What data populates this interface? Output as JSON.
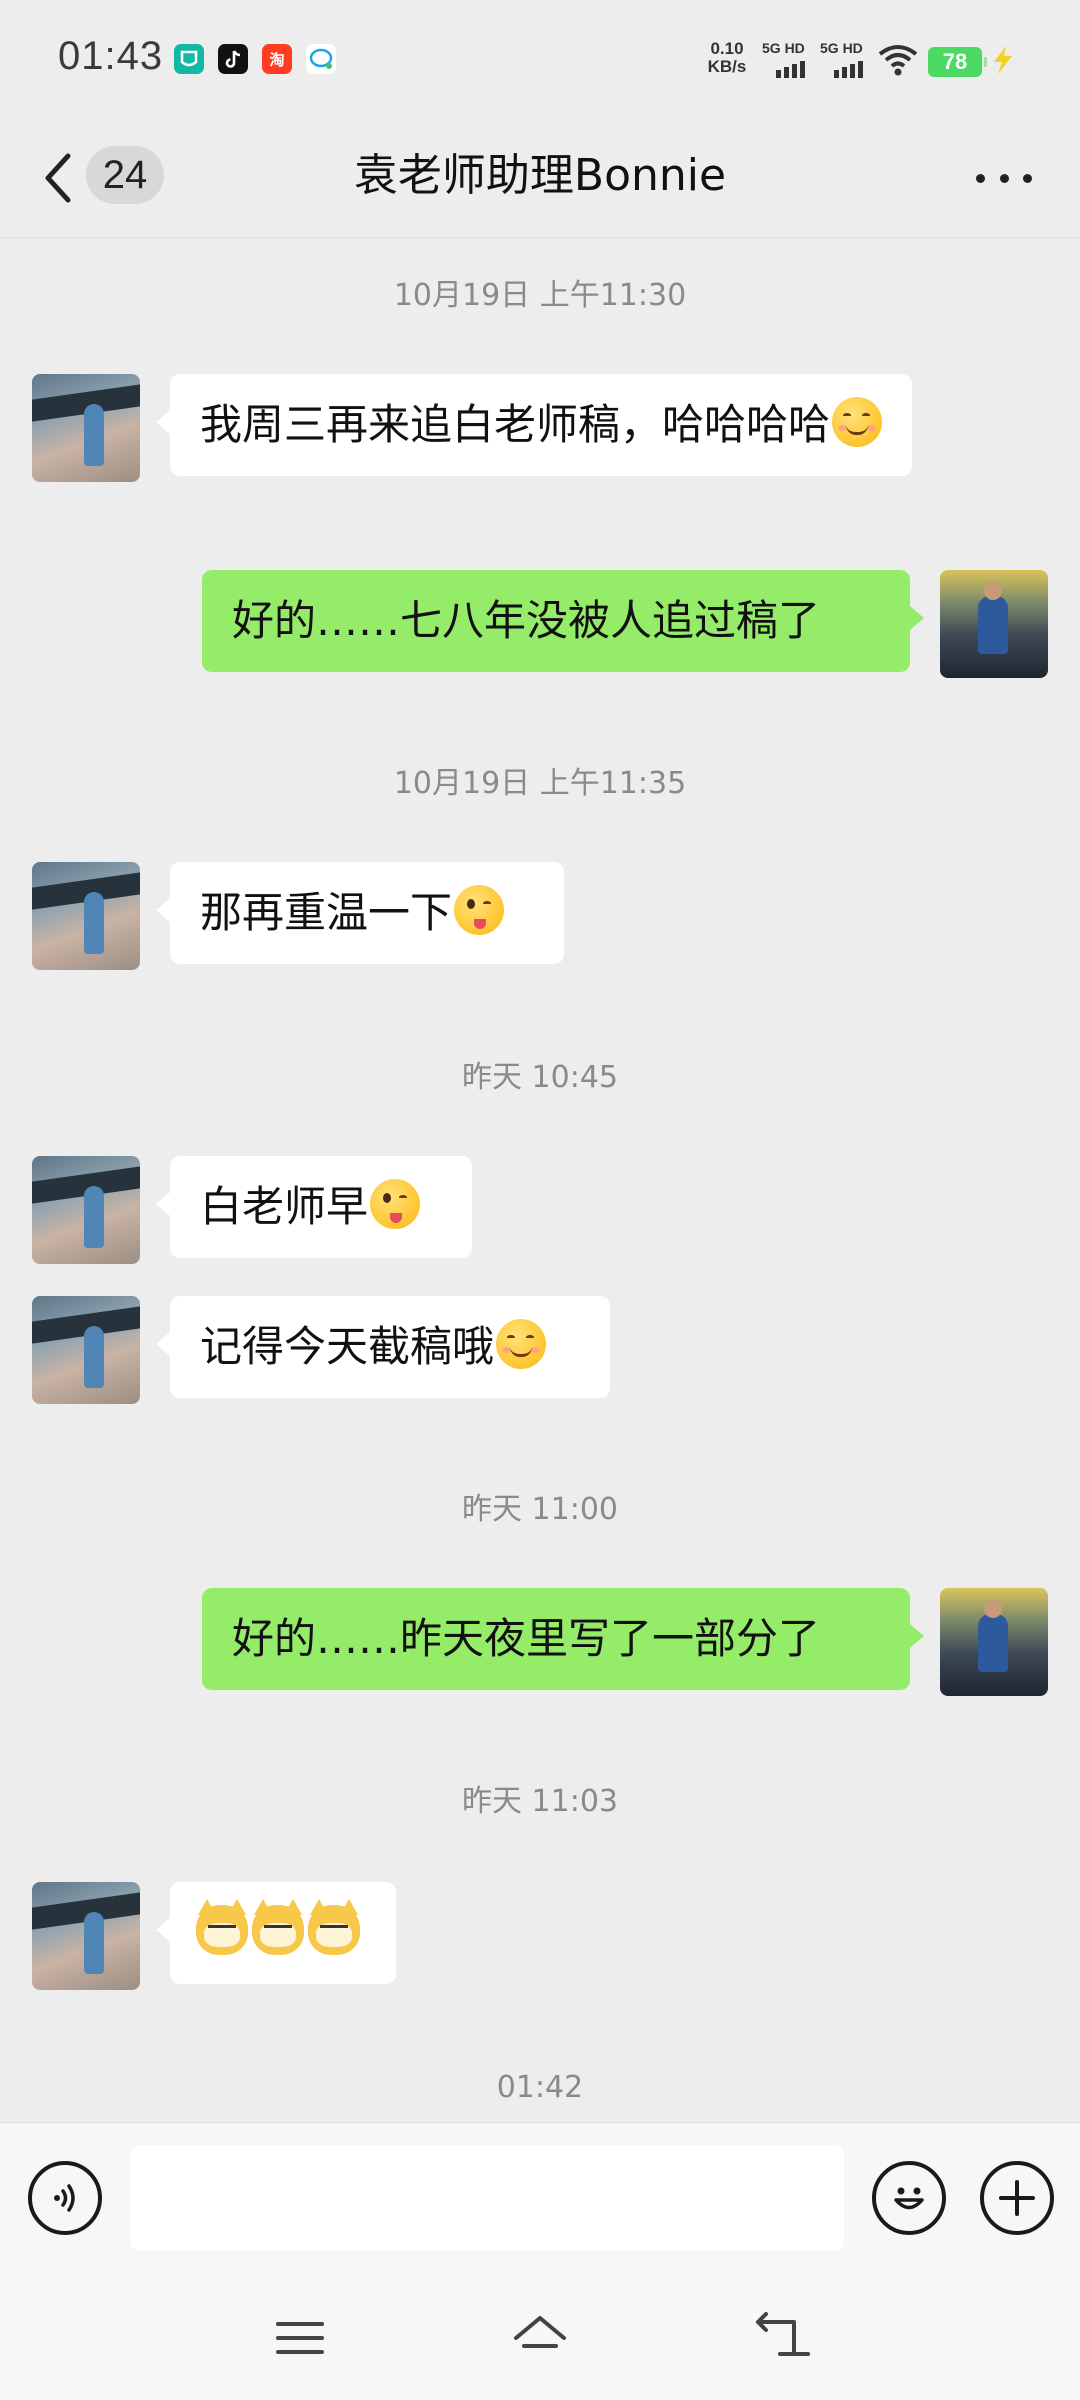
{
  "status_bar": {
    "time": "01:43",
    "net_speed_value": "0.10",
    "net_speed_unit": "KB/s",
    "sim1_label": "5G HD",
    "sim2_label": "5G HD",
    "battery": "78",
    "app_icons": [
      "mi-icon",
      "tiktok-icon",
      "taobao-icon",
      "chat-bubble-icon"
    ],
    "taobao_glyph": "淘"
  },
  "header": {
    "unread_count": "24",
    "title": "袁老师助理Bonnie"
  },
  "messages": [
    {
      "type": "time",
      "text": "10月19日 上午11:30"
    },
    {
      "type": "msg",
      "side": "left",
      "text": "我周三再来追白老师稿，哈哈哈哈",
      "emoji": "smile"
    },
    {
      "type": "msg",
      "side": "right",
      "text": "好的……七八年没被人追过稿了"
    },
    {
      "type": "time",
      "text": "10月19日 上午11:35"
    },
    {
      "type": "msg",
      "side": "left",
      "text": "那再重温一下",
      "emoji": "wink-tongue"
    },
    {
      "type": "time",
      "text": "昨天 10:45"
    },
    {
      "type": "msg",
      "side": "left",
      "text": "白老师早",
      "emoji": "wink-tongue"
    },
    {
      "type": "msg",
      "side": "left",
      "text": "记得今天截稿哦",
      "emoji": "smile"
    },
    {
      "type": "time",
      "text": "昨天 11:00"
    },
    {
      "type": "msg",
      "side": "right",
      "text": "好的……昨天夜里写了一部分了"
    },
    {
      "type": "time",
      "text": "昨天 11:03"
    },
    {
      "type": "msg",
      "side": "left",
      "text": "",
      "emoji": "doge-cat x3"
    },
    {
      "type": "time",
      "text": "01:42"
    }
  ],
  "input_bar": {
    "voice_icon": "voice-icon",
    "emoji_icon": "emoji-icon",
    "plus_icon": "plus-icon",
    "input_value": ""
  },
  "nav_bar": {
    "icons": [
      "menu-icon",
      "home-icon",
      "back-nav-icon"
    ]
  },
  "colors": {
    "background": "#ededed",
    "bubble_sent": "#95ec69",
    "bubble_received": "#ffffff",
    "battery": "#4cd964"
  }
}
